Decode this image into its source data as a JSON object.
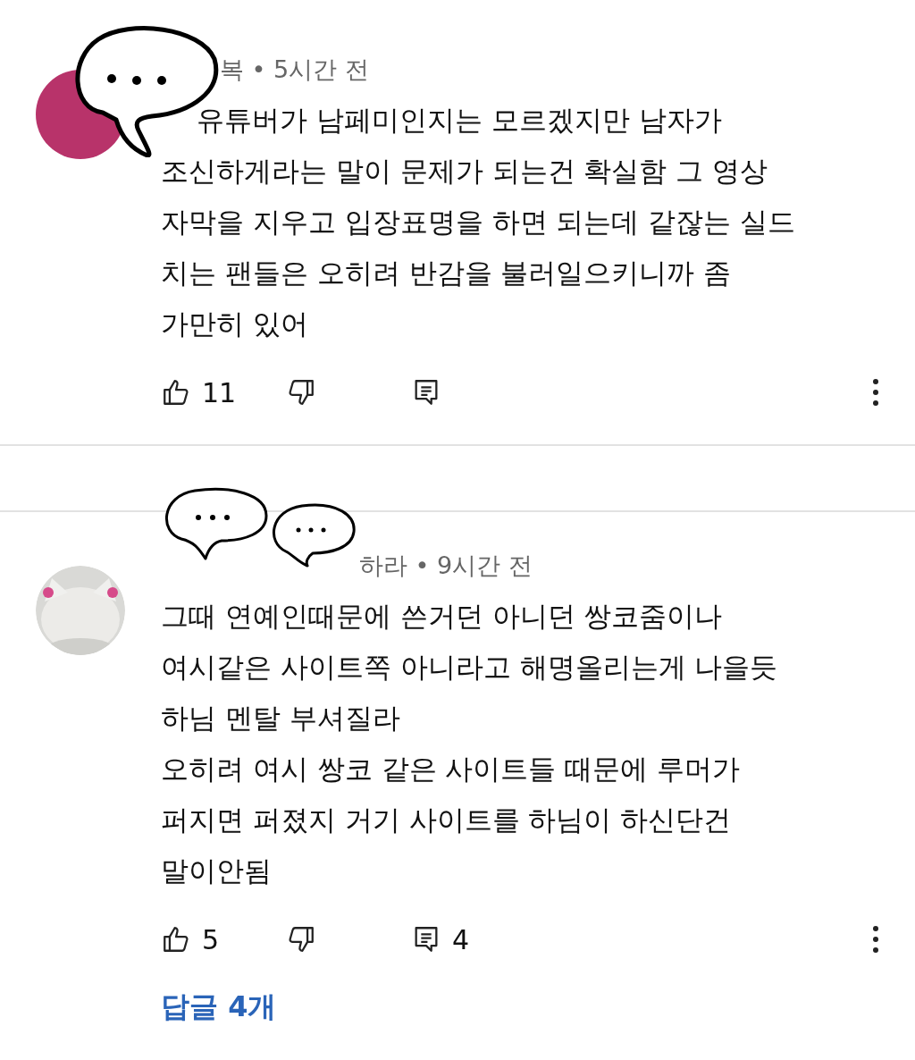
{
  "comments": [
    {
      "avatar": {
        "kind": "plain",
        "color": "#b8336a"
      },
      "meta": "복 • 5시간 전",
      "text": "유튜버가 남페미인지는 모르겠지만 남자가\n조신하게라는 말이 문제가 되는건 확실함 그 영상\n자막을 지우고 입장표명을 하면 되는데 같잖는 실드\n치는 팬들은 오히려 반감을 불러일으키니까 좀\n가만히 있어",
      "likes": "11"
    },
    {
      "meta": "하라 • 9시간 전",
      "text": "그때 연예인때문에 쓴거던 아니던 쌍코줌이나\n여시같은 사이트쪽 아니라고  해명올리는게 나을듯\n하님 멘탈 부셔질라\n오히려 여시 쌍코 같은 사이트들 때문에 루머가\n퍼지면 퍼졌지 거기 사이트를 하님이 하신단건\n말이안됨",
      "likes": "5",
      "reply_count": "4",
      "replies_link": "답글 4개"
    }
  ]
}
